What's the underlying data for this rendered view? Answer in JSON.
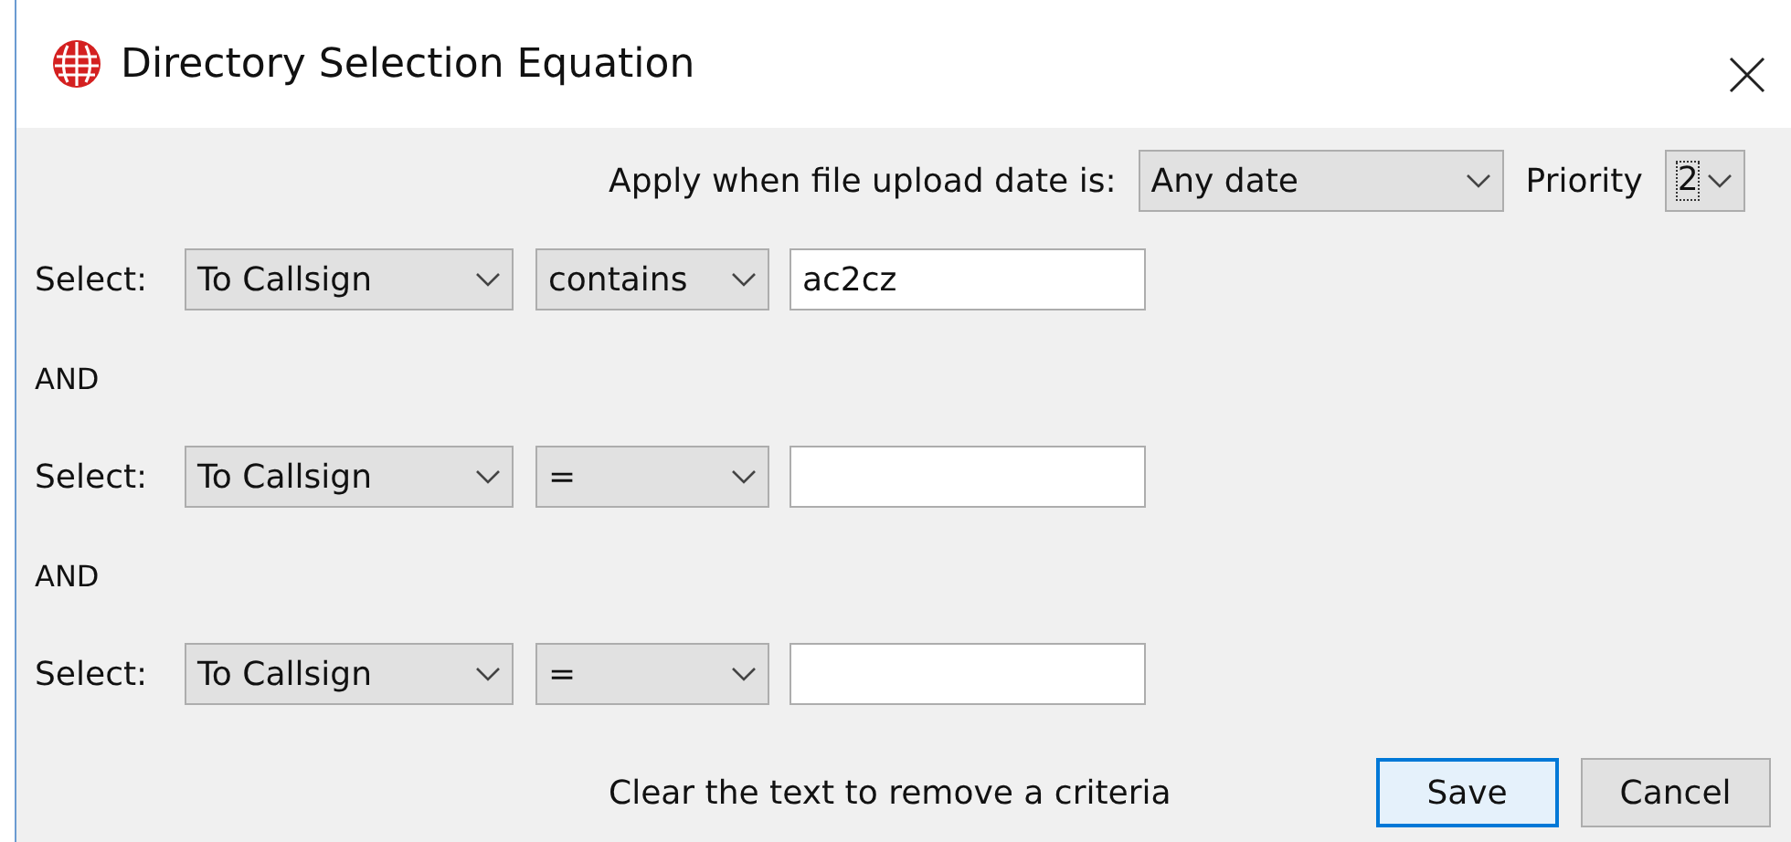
{
  "window": {
    "title": "Directory Selection Equation"
  },
  "date_filter": {
    "label": "Apply when file upload date is:",
    "value": "Any date"
  },
  "priority": {
    "label": "Priority",
    "value": "2",
    "focused": true
  },
  "criteria": [
    {
      "label": "Select:",
      "field": "To Callsign",
      "operator": "contains",
      "value": "ac2cz"
    },
    {
      "kind": "joiner",
      "text": "AND"
    },
    {
      "label": "Select:",
      "field": "To Callsign",
      "operator": "="
    },
    {
      "kind": "joiner",
      "text": "AND"
    },
    {
      "label": "Select:",
      "field": "To Callsign",
      "operator": "="
    }
  ],
  "hint": "Clear the text to remove a criteria",
  "buttons": [
    {
      "label": "Save",
      "default": true
    },
    {
      "label": "Cancel",
      "default": false
    }
  ]
}
